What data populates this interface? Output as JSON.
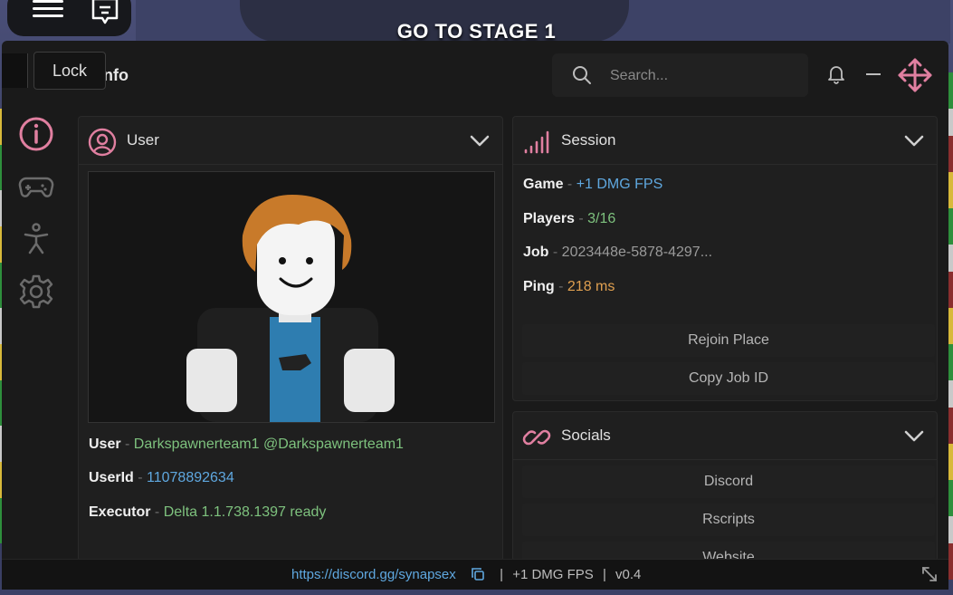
{
  "game": {
    "banner": "GO TO STAGE 1"
  },
  "window": {
    "title": "nfo",
    "tooltip": "Lock",
    "search": {
      "placeholder": "Search..."
    }
  },
  "sidebar": {
    "items": [
      {
        "icon": "info-icon",
        "active": true
      },
      {
        "icon": "gamepad-icon",
        "active": false
      },
      {
        "icon": "accessibility-icon",
        "active": false
      },
      {
        "icon": "gear-icon",
        "active": false
      }
    ]
  },
  "user_panel": {
    "title": "User",
    "fields": [
      {
        "key": "User",
        "value": "Darkspawnerteam1 @Darkspawnerteam1"
      },
      {
        "key": "UserId",
        "value": "11078892634"
      },
      {
        "key": "Executor",
        "value": "Delta 1.1.738.1397  ready"
      }
    ]
  },
  "session_panel": {
    "title": "Session",
    "fields": [
      {
        "key": "Game",
        "value": "+1 DMG FPS"
      },
      {
        "key": "Players",
        "value": "3/16"
      },
      {
        "key": "Job",
        "value": "2023448e-5878-4297..."
      },
      {
        "key": "Ping",
        "value": "218 ms"
      }
    ],
    "buttons": [
      "Rejoin Place",
      "Copy Job ID"
    ]
  },
  "socials_panel": {
    "title": "Socials",
    "buttons": [
      "Discord",
      "Rscripts",
      "Website"
    ]
  },
  "footer": {
    "link": "https://discord.gg/synapsex",
    "game": "+1 DMG FPS",
    "version": "v0.4",
    "separator": "|"
  },
  "colors": {
    "accent": "#e07fa0",
    "panel": "#1f1f1f",
    "background": "#1a1a1a",
    "value_green": "#7ec27e",
    "value_blue": "#5fa8e0",
    "value_orange": "#e0a050"
  }
}
